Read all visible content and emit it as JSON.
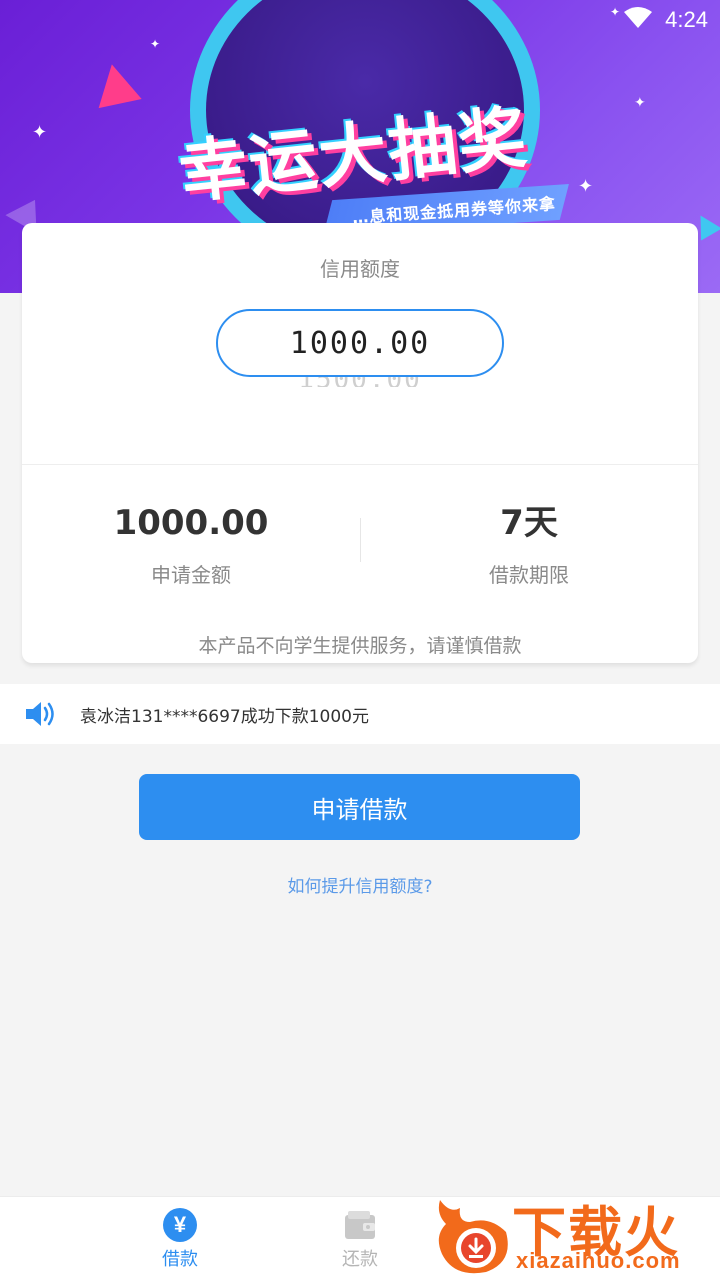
{
  "status_bar": {
    "time": "4:24",
    "wifi_icon": "wifi-icon"
  },
  "banner": {
    "title": "幸运大抽奖",
    "subtitle": "…息和现金抵用券等你来拿"
  },
  "credit_card": {
    "label": "信用额度",
    "selected_amount": "1000.00",
    "next_amount": "1500.00",
    "apply_amount_value": "1000.00",
    "apply_amount_label": "申请金额",
    "term_value": "7天",
    "term_label": "借款期限",
    "notice": "本产品不向学生提供服务，请谨慎借款"
  },
  "marquee": {
    "icon": "speaker-icon",
    "text": "袁冰洁131****6697成功下款1000元"
  },
  "actions": {
    "apply_button": "申请借款",
    "raise_limit_link": "如何提升信用额度?"
  },
  "bottom_nav": {
    "items": [
      {
        "label": "借款",
        "icon": "yen-icon",
        "active": true
      },
      {
        "label": "还款",
        "icon": "wallet-icon",
        "active": false
      }
    ]
  },
  "watermark": {
    "title": "下载火",
    "url": "xiazaihuo.com"
  },
  "colors": {
    "accent": "#2d8ef0",
    "banner_purple": "#7b35e6",
    "watermark_orange": "#f26a1b"
  }
}
